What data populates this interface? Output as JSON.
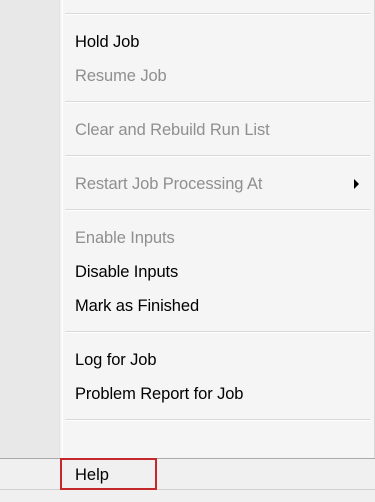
{
  "menu": {
    "items": [
      {
        "label": "Hold Job",
        "enabled": true
      },
      {
        "label": "Resume Job",
        "enabled": false
      },
      {
        "label": "Clear and Rebuild Run List",
        "enabled": false
      },
      {
        "label": "Restart Job Processing At",
        "enabled": false,
        "submenu_icon": "submenu-arrow-icon"
      },
      {
        "label": "Enable Inputs",
        "enabled": false
      },
      {
        "label": "Disable Inputs",
        "enabled": true
      },
      {
        "label": "Mark as Finished",
        "enabled": true
      },
      {
        "label": "Log for Job",
        "enabled": true
      },
      {
        "label": "Problem Report for Job",
        "enabled": true
      }
    ],
    "help_label": "Help",
    "highlight_color": "#c5282b",
    "disabled_text_color": "#8f8f8f"
  }
}
